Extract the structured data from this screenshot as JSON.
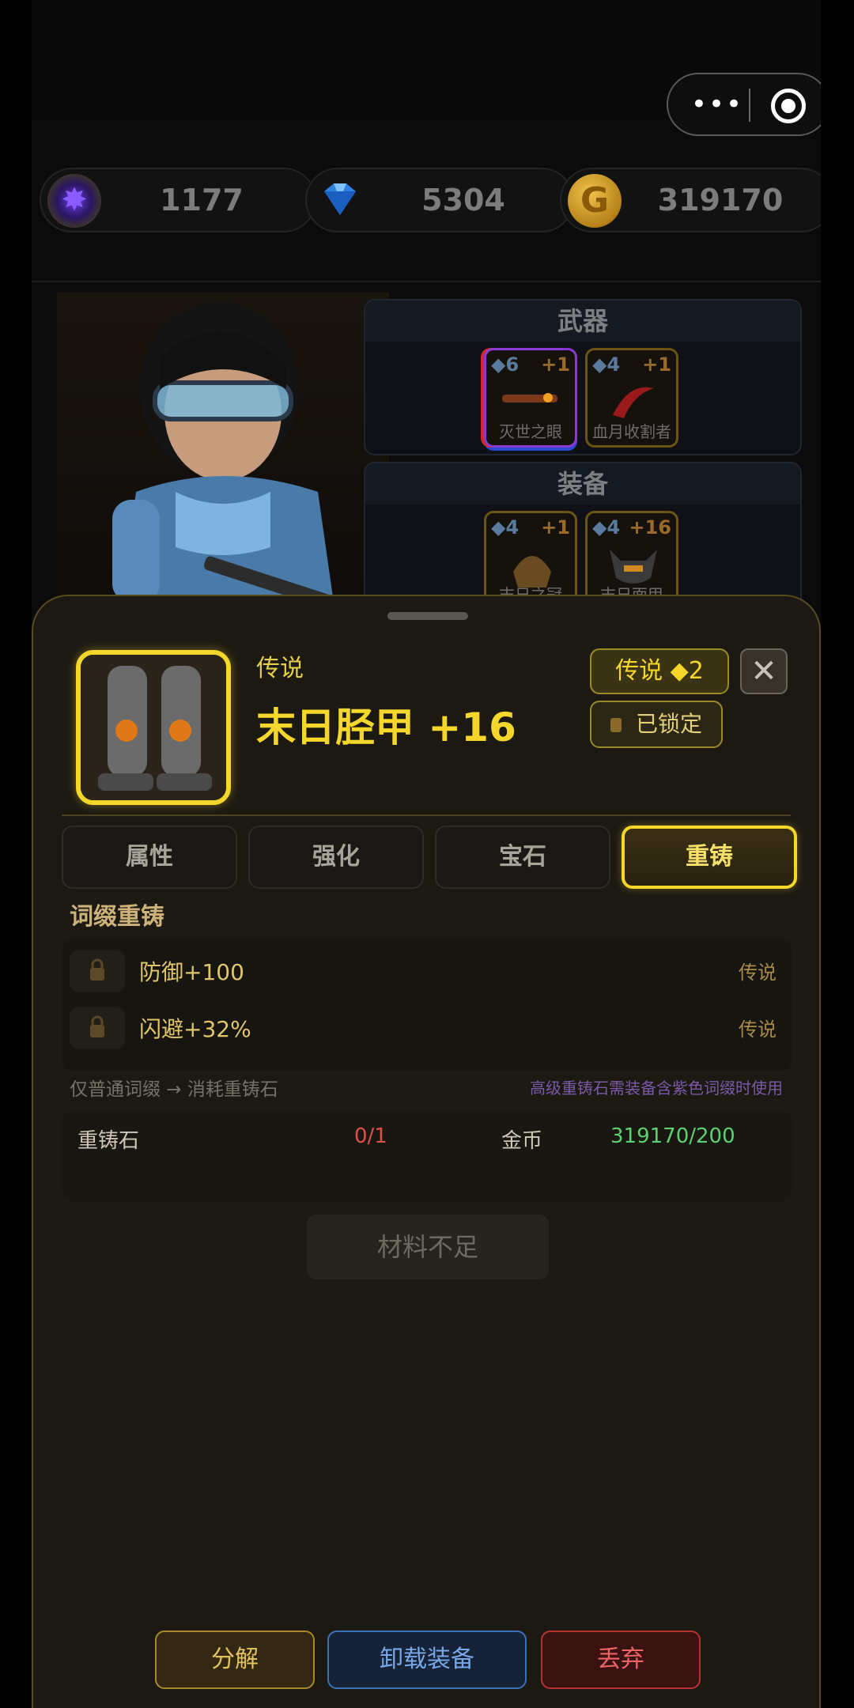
{
  "resources": [
    {
      "icon": "purple-orb-icon",
      "value": "1177"
    },
    {
      "icon": "diamond-icon",
      "value": "5304"
    },
    {
      "icon": "gold-coin-icon",
      "value": "319170"
    }
  ],
  "capsule": {
    "more": "•••",
    "target_icon": "target-icon"
  },
  "panels": {
    "weapons_title": "武器",
    "gear_title": "装备",
    "weapons": [
      {
        "level": "◆6",
        "plus": "+1",
        "name": "灭世之眼"
      },
      {
        "level": "◆4",
        "plus": "+1",
        "name": "血月收割者"
      }
    ],
    "gear": [
      {
        "level": "◆4",
        "plus": "+1",
        "name": "末日之冠"
      },
      {
        "level": "◆4",
        "plus": "+16",
        "name": "末日面甲"
      }
    ]
  },
  "detail": {
    "rarity_label": "传说",
    "title": "末日胫甲 +16",
    "rarity_badge": "传说  ◆2",
    "close": "✕",
    "lock_status": "已锁定"
  },
  "tabs": [
    "属性",
    "强化",
    "宝石",
    "重铸"
  ],
  "reforge": {
    "section_title": "词缀重铸",
    "affixes": [
      {
        "text": "防御+100",
        "rarity": "传说"
      },
      {
        "text": "闪避+32%",
        "rarity": "传说"
      }
    ],
    "hint_left": "仅普通词缀 → 消耗重铸石",
    "hint_right": "高级重铸石需装备含紫色词缀时使用",
    "costs": {
      "stone_label": "重铸石",
      "stone_value": "0/1",
      "gold_label": "金币",
      "gold_value": "319170/200"
    },
    "action": "材料不足"
  },
  "actions": {
    "decompose": "分解",
    "unequip": "卸载装备",
    "discard": "丢弃"
  },
  "colors": {
    "accent_gold": "#f4d72a",
    "insufficient_red": "#e0504a",
    "sufficient_green": "#5fd070",
    "hint_purple": "#7a5aa6"
  }
}
